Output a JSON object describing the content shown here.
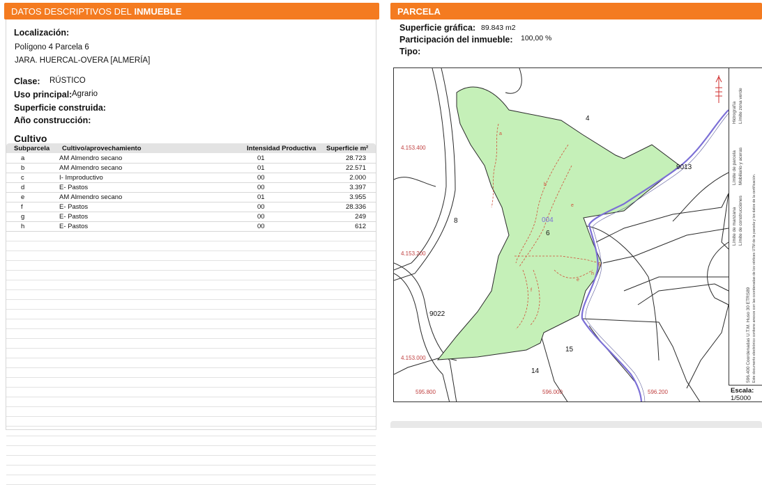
{
  "left": {
    "banner_a": "DATOS DESCRIPTIVOS DEL",
    "banner_b": "INMUEBLE",
    "localizacion_label": "Localización:",
    "loc_line1": "Polígono 4 Parcela 6",
    "loc_line2": "JARA. HUERCAL-OVERA [ALMERÍA]",
    "clase_label": "Clase:",
    "clase_value": "RÚSTICO",
    "uso_label": "Uso principal:",
    "uso_value": "Agrario",
    "sup_label": "Superficie construida:",
    "anio_label": "Año construcción:",
    "cultivo_title": "Cultivo",
    "headers": [
      "Subparcela",
      "Cultivo/aprovechamiento",
      "Intensidad Productiva",
      "Superficie m²"
    ],
    "rows": [
      {
        "sub": "a",
        "cultivo": "AM Almendro secano",
        "int": "01",
        "sup": "28.723"
      },
      {
        "sub": "b",
        "cultivo": "AM Almendro secano",
        "int": "01",
        "sup": "22.571"
      },
      {
        "sub": "c",
        "cultivo": "I- Improductivo",
        "int": "00",
        "sup": "2.000"
      },
      {
        "sub": "d",
        "cultivo": "E- Pastos",
        "int": "00",
        "sup": "3.397"
      },
      {
        "sub": "e",
        "cultivo": "AM Almendro secano",
        "int": "01",
        "sup": "3.955"
      },
      {
        "sub": "f",
        "cultivo": "E- Pastos",
        "int": "00",
        "sup": "28.336"
      },
      {
        "sub": "g",
        "cultivo": "E- Pastos",
        "int": "00",
        "sup": "249"
      },
      {
        "sub": "h",
        "cultivo": "E- Pastos",
        "int": "00",
        "sup": "612"
      }
    ]
  },
  "right": {
    "banner": "PARCELA",
    "sup_graf_label": "Superficie gráfica:",
    "sup_graf_value": "89.843 m2",
    "part_label": "Participación del inmueble:",
    "part_value": "100,00 %",
    "tipo_label": "Tipo:"
  },
  "map": {
    "parcel_colors": {
      "fill": "#c5f0b8",
      "stroke": "#2a2a2a",
      "river": "#7b6fd6",
      "subparcel": "#d0503a"
    },
    "labels": {
      "p4": "4",
      "p8": "8",
      "p6": "6",
      "p15": "15",
      "p14": "14",
      "p9013": "9013",
      "p9022": "9022",
      "code": "004",
      "sub_a": "a",
      "sub_b": "b",
      "sub_c": "c",
      "sub_d": "d",
      "sub_e": "e",
      "sub_f": "f",
      "sub_g": "g",
      "sub_h": "h"
    },
    "coords": {
      "y1": "4.153.400",
      "y2": "4.153.200",
      "y3": "4.153.000",
      "x1": "595.800",
      "x2": "596.000",
      "x3": "596.200"
    },
    "legend": {
      "l1": "Límite de manzana",
      "l2": "Límite de parcela",
      "l3": "Hidrografía",
      "l4": "Límite de construcciones",
      "l5": "Mobiliario y aceras",
      "l6": "Límite zona verde",
      "note1": "596.400 Coordenadas U.T.M. Huso 30 ETRS89",
      "note2": "Este documento electrónico contiene anexos con las coordenadas de los vértices UTM de la parcela y los datos de la certificación."
    },
    "escala_label": "Escala:",
    "escala_value": "1/5000"
  }
}
